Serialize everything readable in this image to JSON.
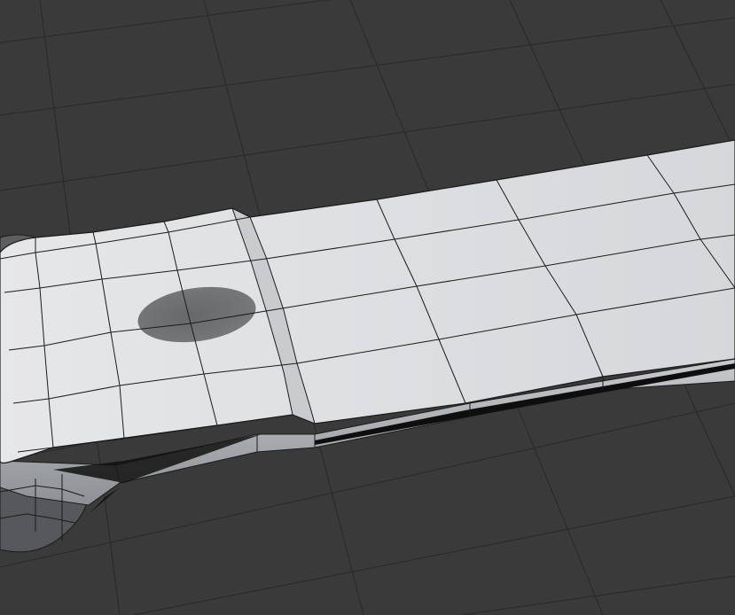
{
  "app": {
    "view": "3d-viewport",
    "shading_mode": "solid",
    "overlay": "wireframe-edges-visible"
  },
  "viewport": {
    "background_color": "#3a3a3a",
    "grid_line_color": "#2b2b2b",
    "grid_visible": true
  },
  "mesh": {
    "object_type": "mesh",
    "description_icon": "mesh-object-icon",
    "surface_color": "#d8dadd",
    "side_color": "#a9acb0",
    "edge_color": "#1b1b1b",
    "dark_part_color": "#5f6165",
    "shadow_blob_color": "#6a6b6d"
  }
}
